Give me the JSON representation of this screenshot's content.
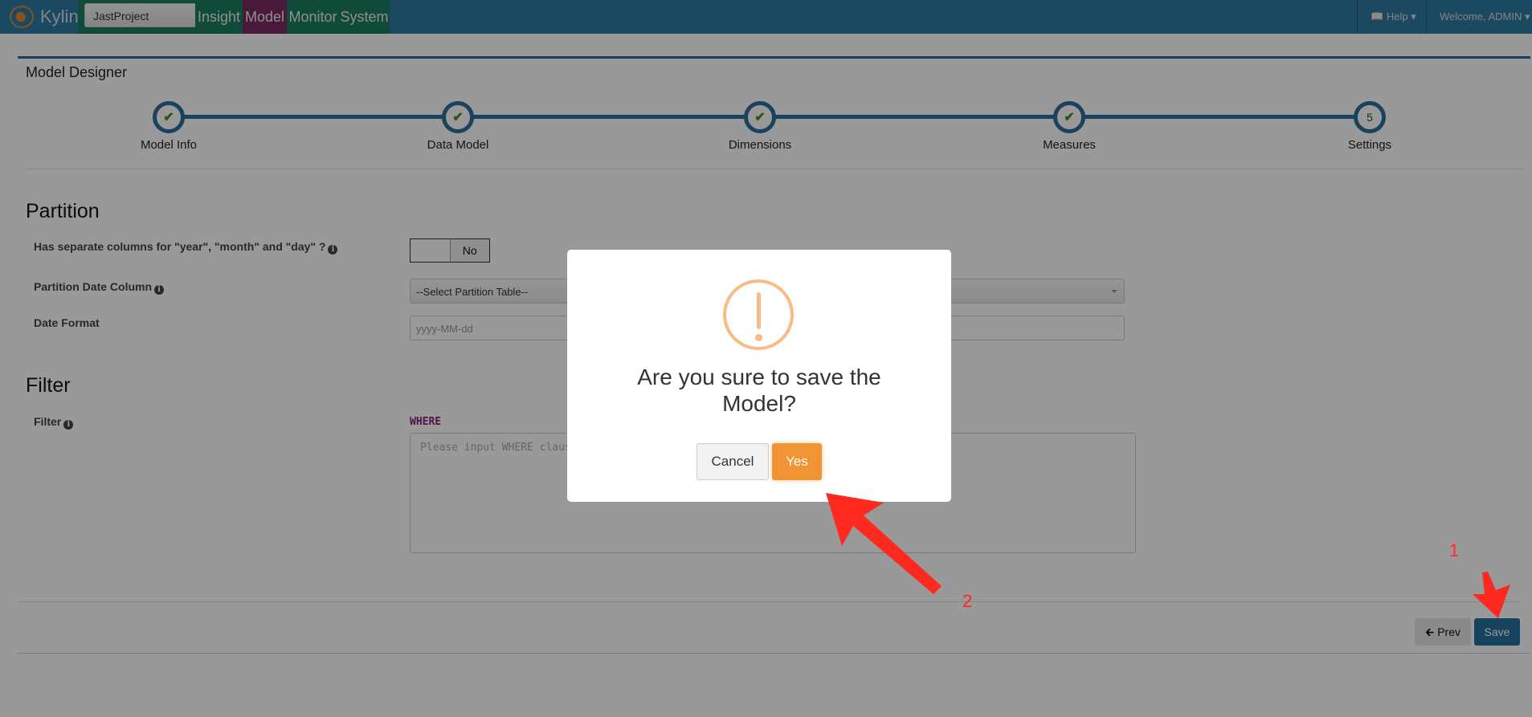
{
  "navbar": {
    "brand": "Kylin",
    "project": "JastProject",
    "tabs": [
      {
        "label": "Insight",
        "color": "#1a7d5e"
      },
      {
        "label": "Model",
        "color": "#7b2b61",
        "active": true
      },
      {
        "label": "Monitor",
        "color": "#1a7d5e"
      },
      {
        "label": "System",
        "color": "#1a7d5e"
      }
    ],
    "help": "Help",
    "welcome": "Welcome, ADMIN"
  },
  "designer": {
    "title": "Model Designer",
    "steps": [
      {
        "label": "Model Info",
        "done": true
      },
      {
        "label": "Data Model",
        "done": true
      },
      {
        "label": "Dimensions",
        "done": true
      },
      {
        "label": "Measures",
        "done": true
      },
      {
        "label": "Settings",
        "done": false,
        "number": "5"
      }
    ]
  },
  "partition": {
    "heading": "Partition",
    "separate_label": "Has separate columns for \"year\", \"month\" and \"day\" ?",
    "toggle_value": "No",
    "date_column_label": "Partition Date Column",
    "date_column_value": "--Select Partition Table--",
    "date_format_label": "Date Format",
    "date_format_placeholder": "yyyy-MM-dd"
  },
  "filter": {
    "heading": "Filter",
    "label": "Filter",
    "keyword": "WHERE",
    "placeholder": "Please input WHERE clause"
  },
  "footer": {
    "prev": "Prev",
    "save": "Save"
  },
  "dialog": {
    "message": "Are you sure to save the Model?",
    "cancel": "Cancel",
    "confirm": "Yes",
    "icon": "warning-icon",
    "accent": "#f19434"
  },
  "annotations": {
    "step1": "1",
    "step2": "2",
    "color": "#ff2a1f"
  }
}
